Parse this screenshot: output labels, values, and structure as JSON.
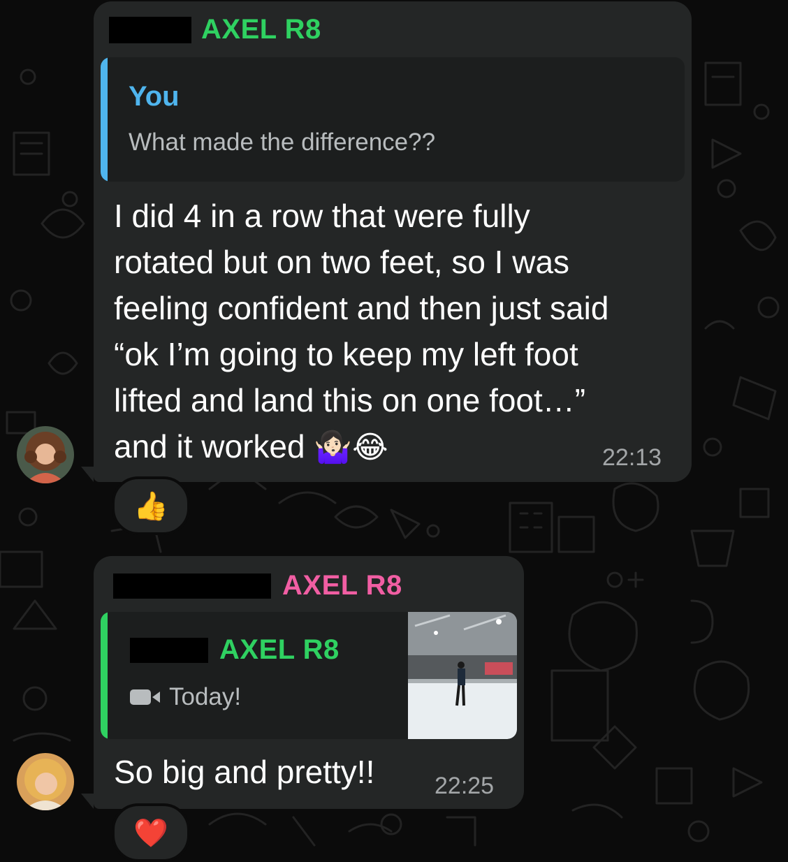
{
  "colors": {
    "bubble": "#242626",
    "quote_bg": "#1c1e1e",
    "sender_green": "#2fd161",
    "sender_pink": "#f15ea3",
    "you_blue": "#4fb5ee"
  },
  "messages": [
    {
      "sender": "AXEL R8",
      "reply": {
        "author": "You",
        "text": "What made the difference??"
      },
      "lines": [
        "I did 4 in a row that were fully",
        "rotated but on two feet, so I was",
        "feeling confident and then just said",
        "“ok I’m going to keep my left foot",
        "lifted and land this on one foot…”",
        "and it worked"
      ],
      "emojis": "🤷🏻‍♀️😂",
      "time": "22:13",
      "reaction": "👍",
      "avatar": "avatar-curly-hair"
    },
    {
      "sender": "AXEL R8",
      "reply": {
        "author": "AXEL R8",
        "icon": "video-camera-icon",
        "text": "Today!",
        "thumbnail": "ice-rink-skater-thumbnail"
      },
      "lines": [
        "So big and pretty!!"
      ],
      "time": "22:25",
      "reaction": "❤️",
      "avatar": "avatar-blonde-hair"
    }
  ]
}
